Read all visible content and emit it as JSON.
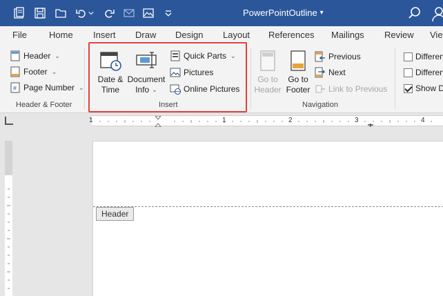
{
  "window": {
    "title": "PowerPointOutline",
    "title_chevron": "▾"
  },
  "tabs": [
    "File",
    "Home",
    "Insert",
    "Draw",
    "Design",
    "Layout",
    "References",
    "Mailings",
    "Review",
    "Vie"
  ],
  "ribbon": {
    "header_footer": {
      "header_label": "Header",
      "footer_label": "Footer",
      "page_number_label": "Page Number",
      "group_label": "Header & Footer"
    },
    "insert": {
      "date_time_line1": "Date &",
      "date_time_line2": "Time",
      "document_info_line1": "Document",
      "document_info_line2": "Info",
      "quick_parts_label": "Quick Parts",
      "pictures_label": "Pictures",
      "online_pictures_label": "Online Pictures",
      "group_label": "Insert"
    },
    "navigation": {
      "go_to_header_line1": "Go to",
      "go_to_header_line2": "Header",
      "go_to_footer_line1": "Go to",
      "go_to_footer_line2": "Footer",
      "previous_label": "Previous",
      "next_label": "Next",
      "link_to_previous_label": "Link to Previous",
      "group_label": "Navigation"
    },
    "options": {
      "different_first_label": "Differen",
      "different_odd_even_label": "Differen",
      "show_document_label": "Show D",
      "show_document_checked": true
    }
  },
  "ruler": {
    "labels": [
      "1",
      "1",
      "2",
      "3",
      "4"
    ]
  },
  "document": {
    "header_tag": "Header"
  },
  "colors": {
    "title_bar": "#2b579a",
    "highlight_border": "#e0413d",
    "ribbon_bg": "#f3f3f3"
  }
}
